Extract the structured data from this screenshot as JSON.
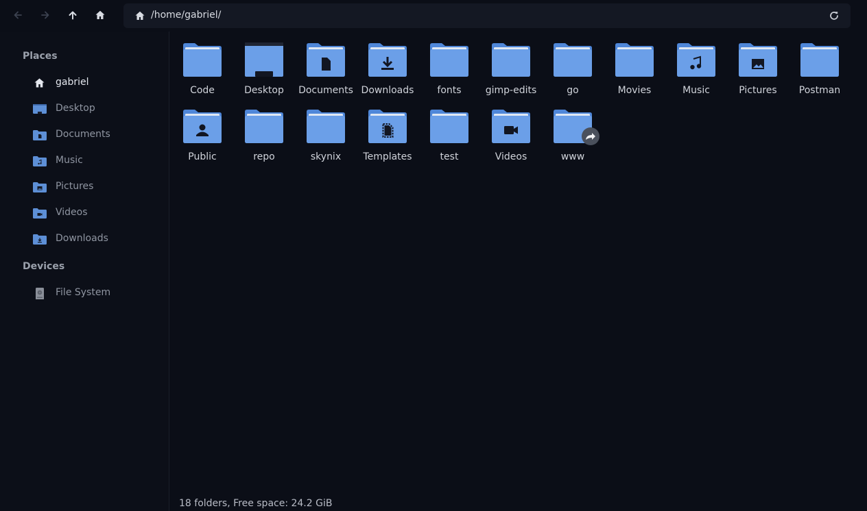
{
  "toolbar": {
    "path": "/home/gabriel/"
  },
  "sidebar": {
    "places_title": "Places",
    "places": [
      {
        "label": "gabriel",
        "icon": "home-icon"
      },
      {
        "label": "Desktop",
        "icon": "desktop-folder-icon"
      },
      {
        "label": "Documents",
        "icon": "documents-folder-icon"
      },
      {
        "label": "Music",
        "icon": "music-folder-icon"
      },
      {
        "label": "Pictures",
        "icon": "pictures-folder-icon"
      },
      {
        "label": "Videos",
        "icon": "videos-folder-icon"
      },
      {
        "label": "Downloads",
        "icon": "downloads-folder-icon"
      }
    ],
    "devices_title": "Devices",
    "devices": [
      {
        "label": "File System",
        "icon": "drive-icon"
      }
    ]
  },
  "folders": [
    {
      "name": "Code",
      "emblem": "none"
    },
    {
      "name": "Desktop",
      "emblem": "desktop"
    },
    {
      "name": "Documents",
      "emblem": "document"
    },
    {
      "name": "Downloads",
      "emblem": "download"
    },
    {
      "name": "fonts",
      "emblem": "none"
    },
    {
      "name": "gimp-edits",
      "emblem": "none"
    },
    {
      "name": "go",
      "emblem": "none"
    },
    {
      "name": "Movies",
      "emblem": "none"
    },
    {
      "name": "Music",
      "emblem": "music"
    },
    {
      "name": "Pictures",
      "emblem": "picture"
    },
    {
      "name": "Postman",
      "emblem": "none"
    },
    {
      "name": "Public",
      "emblem": "public"
    },
    {
      "name": "repo",
      "emblem": "none"
    },
    {
      "name": "skynix",
      "emblem": "none"
    },
    {
      "name": "Templates",
      "emblem": "template"
    },
    {
      "name": "test",
      "emblem": "none"
    },
    {
      "name": "Videos",
      "emblem": "video"
    },
    {
      "name": "www",
      "emblem": "symlink"
    }
  ],
  "status": "18 folders, Free space: 24.2 GiB",
  "colors": {
    "background": "#0b0e17",
    "folder": "#6b9fe8",
    "folder_dark": "#4f87d9",
    "accent_text": "#e4e7ee"
  }
}
